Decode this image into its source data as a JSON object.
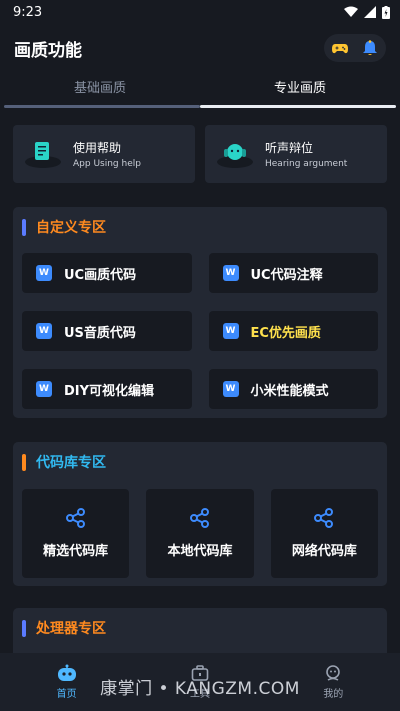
{
  "status": {
    "time": "9:23"
  },
  "appbar": {
    "title": "画质功能"
  },
  "tabs": [
    {
      "label": "基础画质"
    },
    {
      "label": "专业画质"
    }
  ],
  "help": [
    {
      "zh": "使用帮助",
      "en": "App Using help"
    },
    {
      "zh": "听声辩位",
      "en": "Hearing argument"
    }
  ],
  "custom": {
    "title": "自定义专区",
    "title_color": "#ff8a1f",
    "items": [
      {
        "label": "UC画质代码"
      },
      {
        "label": "UC代码注释"
      },
      {
        "label": "US音质代码"
      },
      {
        "label": "EC优先画质",
        "highlight": "#ffe14d"
      },
      {
        "label": "DIY可视化编辑"
      },
      {
        "label": "小米性能模式"
      }
    ]
  },
  "codelib": {
    "title": "代码库专区",
    "title_color": "#31b9f0",
    "items": [
      {
        "label": "精选代码库"
      },
      {
        "label": "本地代码库"
      },
      {
        "label": "网络代码库"
      }
    ]
  },
  "processor": {
    "title": "处理器专区",
    "title_color": "#ff8a1f"
  },
  "nav": [
    {
      "label": "首页"
    },
    {
      "label": "工具"
    },
    {
      "label": "我的"
    }
  ],
  "watermark": "康掌门 • KANGZM.COM",
  "colors": {
    "accent": "#4fb8ff",
    "background": "#171a21",
    "card": "#232833"
  }
}
